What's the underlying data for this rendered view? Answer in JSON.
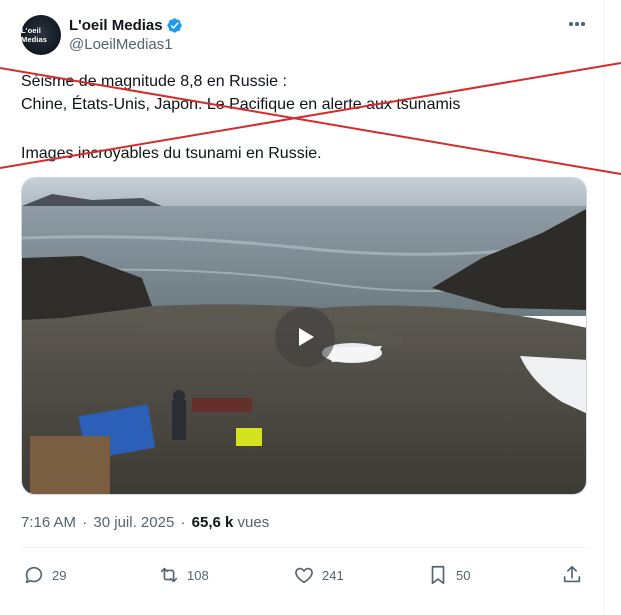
{
  "author": {
    "avatar_text": "L'oeil Medias",
    "name": "L'oeil Medias",
    "handle": "@LoeilMedias1",
    "verified": true
  },
  "tweet": {
    "lines": [
      "Séisme de magnitude 8,8 en Russie :",
      "Chine, États-Unis, Japon. Le Pacifique en alerte aux tsunamis",
      "Images incroyables du tsunami en Russie."
    ],
    "strike_color": "#d62b2b"
  },
  "meta": {
    "time": "7:16 AM",
    "date": "30 juil. 2025",
    "views_count": "65,6 k",
    "views_label": "vues"
  },
  "actions": {
    "replies": "29",
    "reposts": "108",
    "likes": "241",
    "bookmarks": "50"
  },
  "colors": {
    "text": "#0f1419",
    "secondary": "#536471",
    "verified": "#1d9bf0"
  }
}
